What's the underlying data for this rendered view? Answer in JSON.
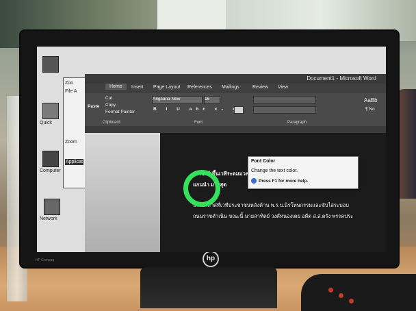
{
  "word": {
    "title": "Document1 - Microsoft Word",
    "tabs": [
      "Home",
      "Insert",
      "Page Layout",
      "References",
      "Mailings",
      "Review",
      "View"
    ],
    "clipboard": {
      "paste": "Paste",
      "cut": "Cut",
      "copy": "Copy",
      "format_painter": "Format Painter",
      "group_label": "Clipboard"
    },
    "font": {
      "name": "Angsana New",
      "size": "16",
      "group_label": "Font"
    },
    "paragraph_group_label": "Paragraph",
    "styles_preview": "AaBb",
    "styles_normal": "¶ No",
    "tooltip": {
      "title": "Font Color",
      "description": "Change the text color.",
      "help": "Press F1 for more help."
    },
    "document_lines": [
      "เขาชิงห์ ขึ้นเวทีระดมมวลชน เฌินปลัดเตือน ขบวนไป 14 กระทรวง",
      "แกนนำ มากสุด",
      "บรรยากาศที่เวทีประชาชนหลังค้าน พ.ร.บ.นิรโทษกรรมและขับไล่ระบอบ",
      "ถนนราชดำเนิน ขณะนี้ นายสาทิตย์ วงศ์หนองเตย อดีต ส.ส.ตรัง พรรคประ"
    ]
  },
  "desktop": {
    "zoom_window_title": "Zoo",
    "zoom_window_menu": "File A",
    "zoom_app_label": "Zoom",
    "application_label": "Applicat",
    "icons": [
      "Quick",
      "Computer",
      "Network"
    ]
  },
  "monitor": {
    "logo": "hp",
    "model": "HP Compaq"
  },
  "colors": {
    "highlight_circle": "#35e05a",
    "cursor": "#3fd86a"
  }
}
